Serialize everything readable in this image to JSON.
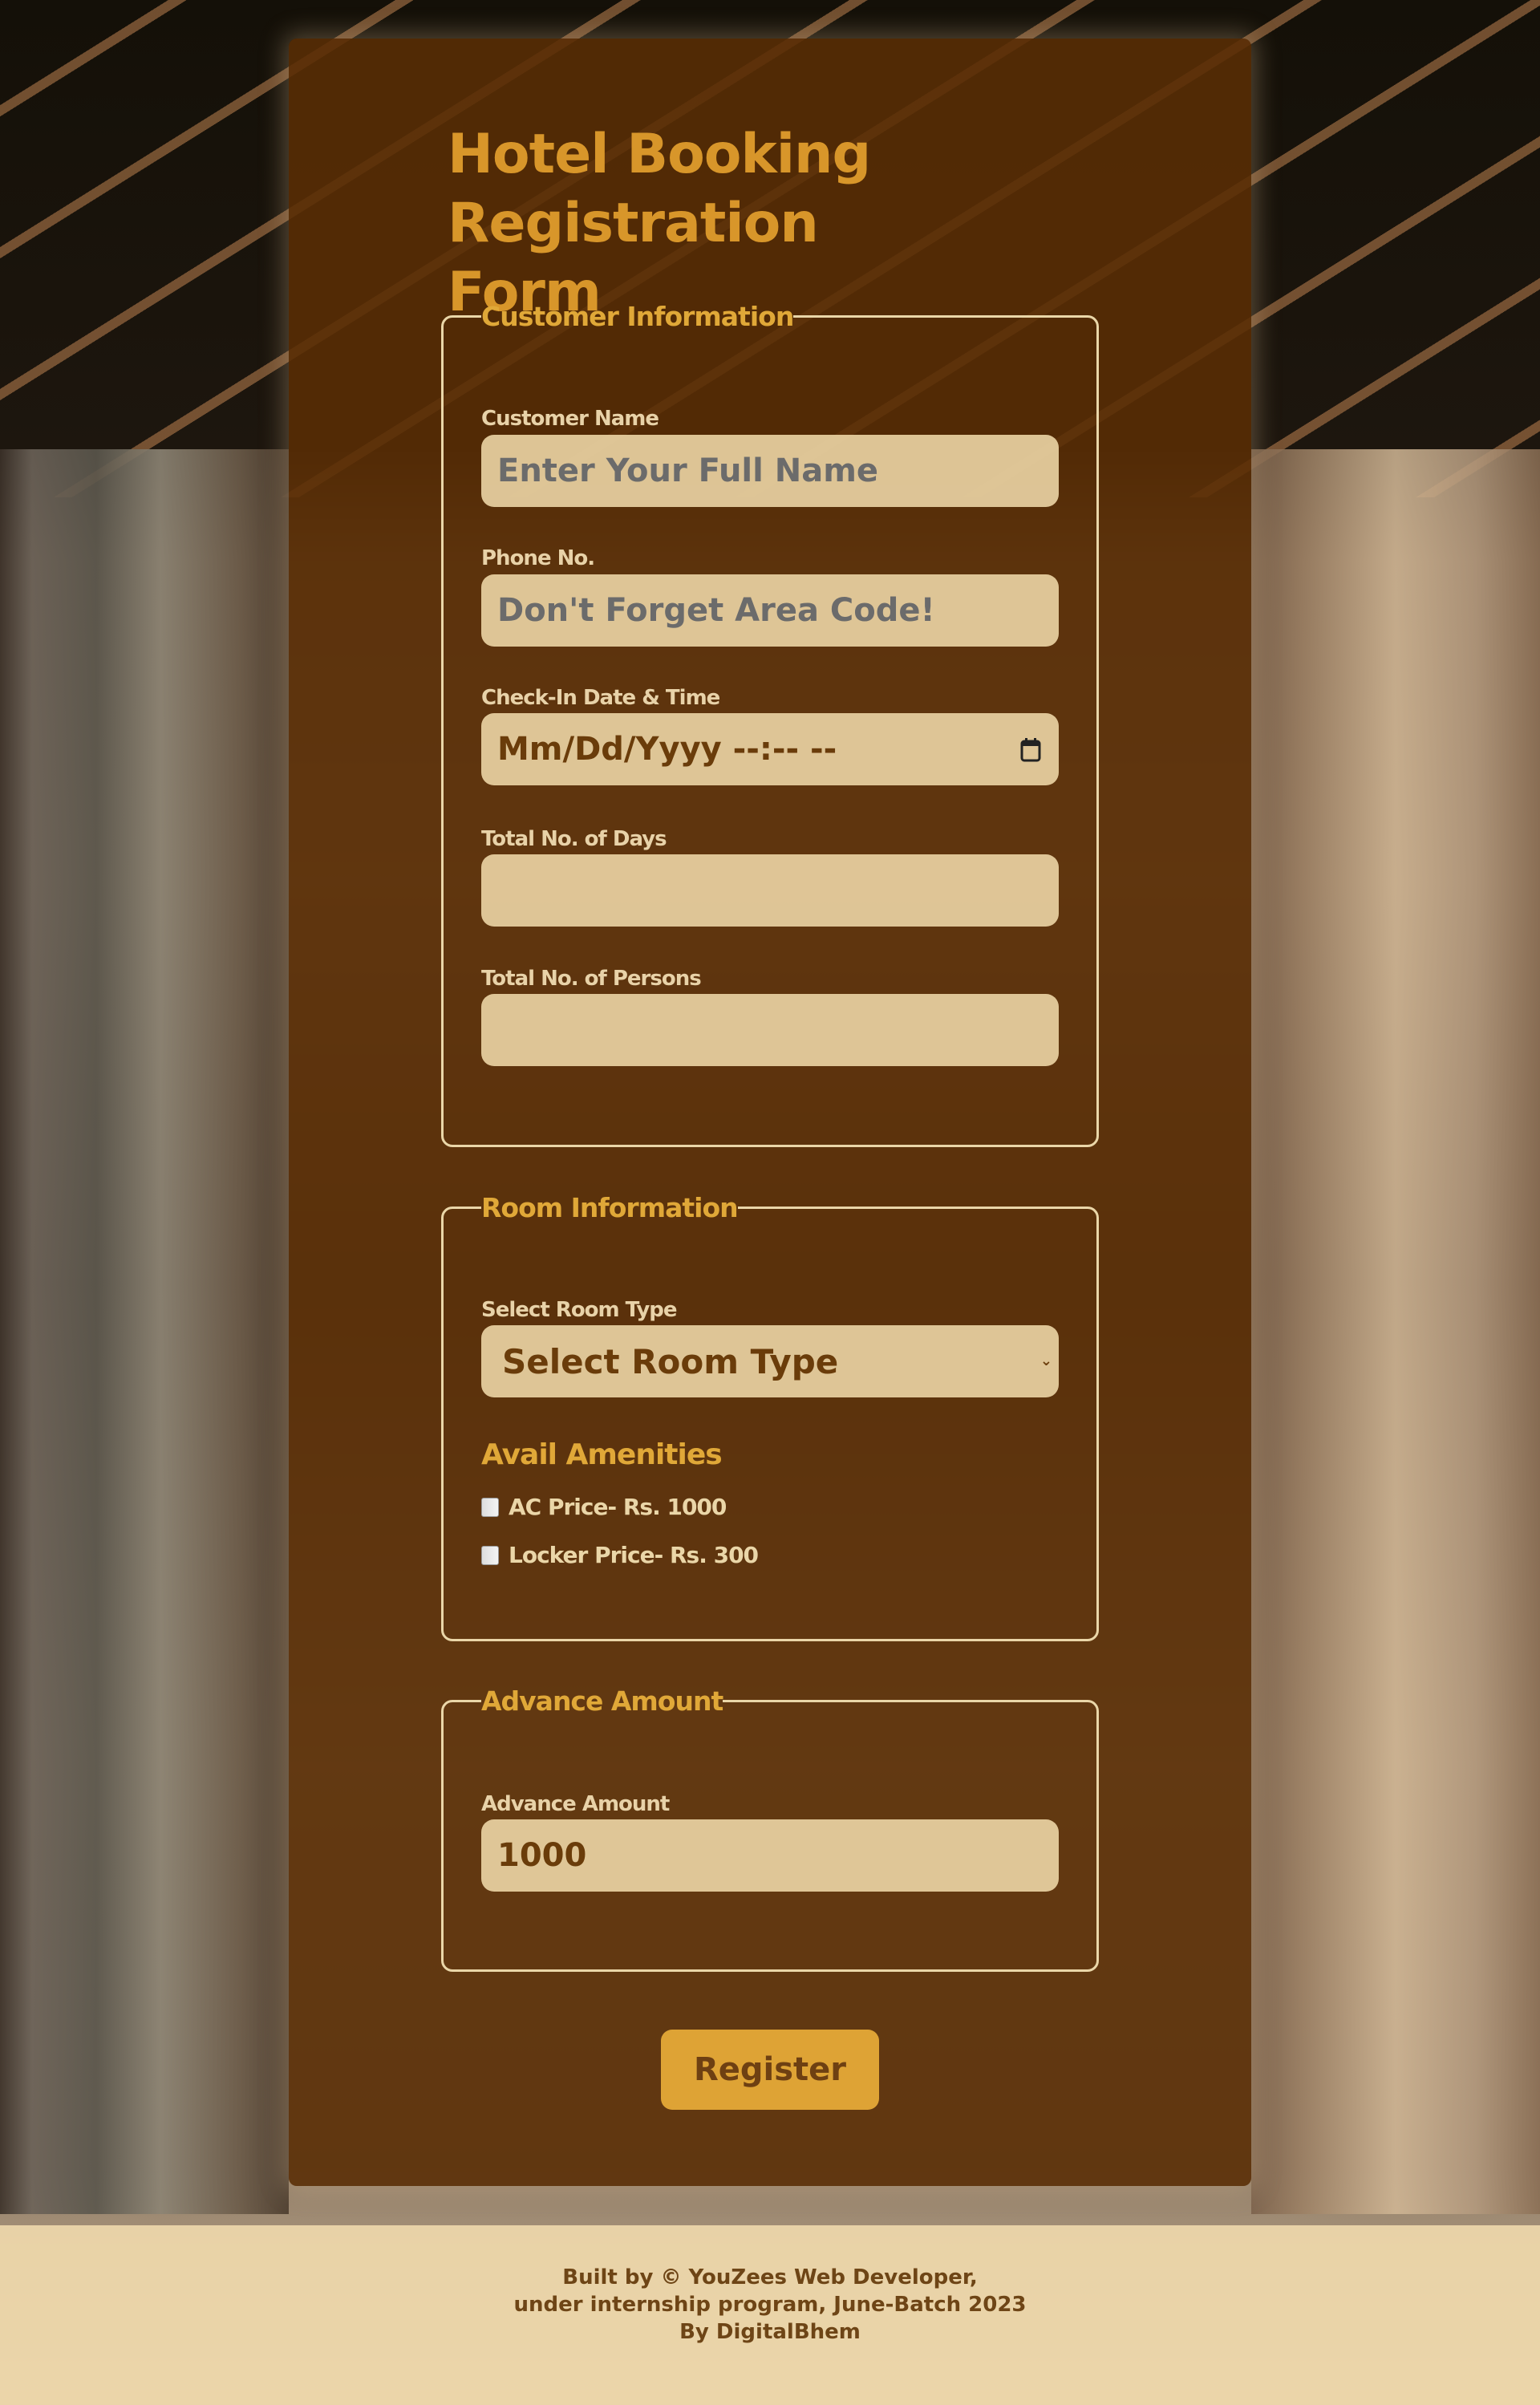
{
  "page": {
    "title": "Hotel Booking Registration Form"
  },
  "sections": {
    "customer": {
      "legend": "Customer Information",
      "fields": {
        "name": {
          "label": "Customer Name",
          "placeholder": "Enter Your Full Name",
          "value": ""
        },
        "phone": {
          "label": "Phone No.",
          "placeholder": "Don't Forget Area Code!",
          "value": ""
        },
        "checkin": {
          "label": "Check-In Date & Time",
          "display": "Mm/Dd/Yyyy --:-- --",
          "icon": "calendar-icon"
        },
        "days": {
          "label": "Total No. of Days",
          "value": ""
        },
        "persons": {
          "label": "Total No. of Persons",
          "value": ""
        }
      }
    },
    "room": {
      "legend": "Room Information",
      "room_type": {
        "label": "Select Room Type",
        "selected": "Select Room Type",
        "icon": "chevron-down-icon"
      },
      "amenities": {
        "heading": "Avail Amenities",
        "items": [
          {
            "label": "AC Price- Rs. 1000",
            "checked": false
          },
          {
            "label": "Locker Price- Rs. 300",
            "checked": false
          }
        ]
      }
    },
    "advance": {
      "legend": "Advance Amount",
      "field": {
        "label": "Advance Amount",
        "value": "1000"
      }
    }
  },
  "actions": {
    "register_label": "Register"
  },
  "footer": {
    "line1": "Built by © YouZees Web Developer,",
    "line2": "under internship program, June-Batch 2023",
    "line3": "By DigitalBhem"
  },
  "colors": {
    "accent": "#dea335",
    "title": "#d8962a",
    "card": "#5a2d05",
    "input_bg": "#f0daaa",
    "text_dark": "#6e4012"
  }
}
